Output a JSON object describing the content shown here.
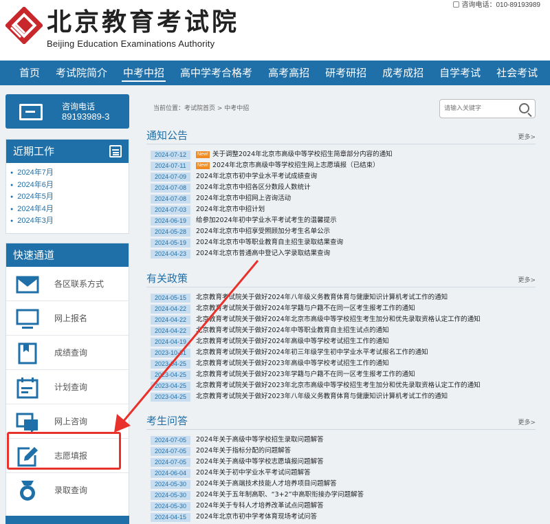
{
  "header": {
    "logo_cn": "北京教育考试院",
    "logo_en": "Beijing Education Examinations Authority",
    "hotline": "咨询电话：010-89193989"
  },
  "nav": {
    "items": [
      {
        "label": "首页"
      },
      {
        "label": "考试院简介"
      },
      {
        "label": "中考中招",
        "active": true
      },
      {
        "label": "高中学考合格考"
      },
      {
        "label": "高考高招"
      },
      {
        "label": "研考研招"
      },
      {
        "label": "成考成招"
      },
      {
        "label": "自学考试"
      },
      {
        "label": "社会考试"
      }
    ]
  },
  "sidebar": {
    "contact_label": "咨询电话",
    "contact_number": "89193989-3",
    "recent_title": "近期工作",
    "recent_items": [
      "2024年7月",
      "2024年6月",
      "2024年5月",
      "2024年4月",
      "2024年3月"
    ],
    "quick_title": "快速通道",
    "quick_items": [
      {
        "label": "各区联系方式",
        "icon": "mail-icon"
      },
      {
        "label": "网上报名",
        "icon": "monitor-icon"
      },
      {
        "label": "成绩查询",
        "icon": "bookmark-icon"
      },
      {
        "label": "计划查询",
        "icon": "calendar-icon"
      },
      {
        "label": "网上咨询",
        "icon": "chat-icon"
      },
      {
        "label": "志愿填报",
        "icon": "edit-icon"
      },
      {
        "label": "录取查询",
        "icon": "badge-icon"
      }
    ]
  },
  "main": {
    "breadcrumb": "当前位置：考试院首页 > 中考中招",
    "search_placeholder": "请输入关键字",
    "sections": [
      {
        "title": "通知公告",
        "more": "更多>",
        "items": [
          {
            "date": "2024-07-12",
            "new": "New!",
            "title": "关于调整2024年北京市高级中等学校招生简章部分内容的通知"
          },
          {
            "date": "2024-07-11",
            "new": "New!",
            "title": "2024年北京市高级中等学校招生网上志愿填报（已结束）"
          },
          {
            "date": "2024-07-09",
            "title": "2024年北京市初中学业水平考试成绩查询"
          },
          {
            "date": "2024-07-08",
            "title": "2024年北京市中招各区分数段人数统计"
          },
          {
            "date": "2024-07-08",
            "title": "2024年北京市中招网上咨询活动"
          },
          {
            "date": "2024-07-03",
            "title": "2024年北京市中招计划"
          },
          {
            "date": "2024-06-19",
            "title": "给参加2024年初中学业水平考试考生的温馨提示"
          },
          {
            "date": "2024-05-28",
            "title": "2024年北京市中招享受照顾加分考生名单公示"
          },
          {
            "date": "2024-05-19",
            "title": "2024年北京市中等职业教育自主招生录取结果查询"
          },
          {
            "date": "2024-04-23",
            "title": "2024年北京市普通高中登记入学录取结果查询"
          }
        ]
      },
      {
        "title": "有关政策",
        "more": "更多>",
        "items": [
          {
            "date": "2024-05-15",
            "title": "北京教育考试院关于做好2024年八年级义务教育体育与健康知识计算机考试工作的通知"
          },
          {
            "date": "2024-04-22",
            "title": "北京教育考试院关于做好2024年学籍与户籍不在同一区考生报考工作的通知"
          },
          {
            "date": "2024-04-22",
            "title": "北京教育考试院关于做好2024年北京市高级中等学校招生考生加分和优先录取资格认定工作的通知"
          },
          {
            "date": "2024-04-22",
            "title": "北京教育考试院关于做好2024年中等职业教育自主招生试点的通知"
          },
          {
            "date": "2024-04-19",
            "title": "北京教育考试院关于做好2024年高级中等学校考试招生工作的通知"
          },
          {
            "date": "2023-10-31",
            "title": "北京教育考试院关于做好2024年初三年级学生初中学业水平考试报名工作的通知"
          },
          {
            "date": "2023-04-25",
            "title": "北京教育考试院关于做好2023年高级中等学校考试招生工作的通知"
          },
          {
            "date": "2023-04-25",
            "title": "北京教育考试院关于做好2023年学籍与户籍不在同一区考生报考工作的通知"
          },
          {
            "date": "2023-04-25",
            "title": "北京教育考试院关于做好2023年北京市高级中等学校招生考生加分和优先录取资格认定工作的通知"
          },
          {
            "date": "2023-04-25",
            "title": "北京教育考试院关于做好2023年八年级义务教育体育与健康知识计算机考试工作的通知"
          }
        ]
      },
      {
        "title": "考生问答",
        "more": "更多>",
        "items": [
          {
            "date": "2024-07-05",
            "title": "2024年关于高级中等学校招生录取问题解答"
          },
          {
            "date": "2024-07-05",
            "title": "2024年关于指标分配的问题解答"
          },
          {
            "date": "2024-07-05",
            "title": "2024年关于高级中等学校志愿填报问题解答"
          },
          {
            "date": "2024-06-04",
            "title": "2024年关于初中学业水平考试问题解答"
          },
          {
            "date": "2024-05-30",
            "title": "2024年关于高端技术技能人才培养项目问题解答"
          },
          {
            "date": "2024-05-30",
            "title": "2024年关于五年制高职、“3+2”中高职衔接办学问题解答"
          },
          {
            "date": "2024-05-30",
            "title": "2024年关于专科人才培养改革试点问题解答"
          },
          {
            "date": "2024-04-15",
            "title": "2024年北京市初中学考体育现场考试问答"
          }
        ]
      }
    ]
  },
  "colors": {
    "brand_blue": "#1f6fa8",
    "date_bg": "#c8def0",
    "new_badge": "#f08a22",
    "annotation_red": "#e8312a"
  }
}
